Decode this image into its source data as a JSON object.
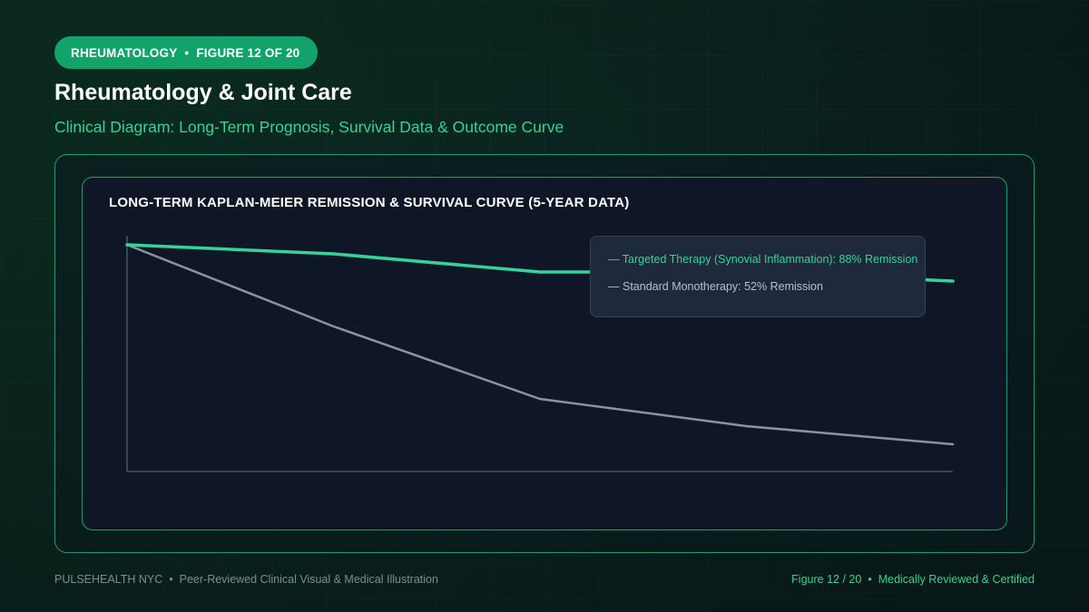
{
  "header": {
    "section": "RHEUMATOLOGY",
    "separator": "•",
    "figure": "FIGURE 12 OF 20",
    "title": "Rheumatology & Joint Care",
    "subtitle": "Clinical Diagram: Long-Term Prognosis, Survival Data & Outcome Curve"
  },
  "chart_data": {
    "type": "line",
    "title": "LONG-TERM KAPLAN-MEIER REMISSION & SURVIVAL CURVE (5-YEAR DATA)",
    "xlabel": "",
    "ylabel": "",
    "x": [
      0,
      1,
      2,
      3,
      4
    ],
    "ylim": [
      0,
      100
    ],
    "grid": false,
    "legend_position": "top-right",
    "series": [
      {
        "name": "Targeted Therapy (Synovial Inflammation): 88% Remission",
        "color": "#35d399",
        "values": [
          100,
          96,
          88,
          88,
          84
        ]
      },
      {
        "name": "Standard Monotherapy: 52% Remission",
        "color": "#8a93a6",
        "values": [
          100,
          64,
          32,
          20,
          12
        ]
      }
    ]
  },
  "legend": {
    "marker": "—"
  },
  "footer": {
    "brand": "PULSEHEALTH NYC",
    "separator": "•",
    "tagline": "Peer-Reviewed Clinical Visual & Medical Illustration",
    "figure_label": "Figure 12 / 20",
    "certification": "Medically Reviewed & Certified"
  }
}
